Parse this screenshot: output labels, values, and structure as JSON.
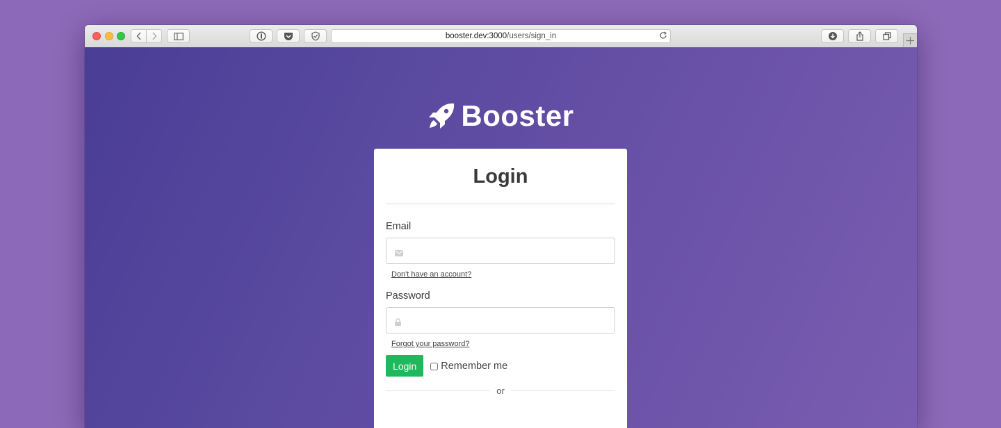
{
  "browser": {
    "url_host": "booster.dev:3000",
    "url_path": "/users/sign_in",
    "toolbar_icons": [
      "back-icon",
      "forward-icon",
      "sidebar-icon",
      "password-manager-icon",
      "pocket-icon",
      "shield-icon",
      "reload-icon",
      "download-icon",
      "share-icon",
      "tabs-icon",
      "new-tab-icon"
    ]
  },
  "brand": {
    "name": "Booster",
    "icon": "rocket-icon",
    "color": "#ffffff"
  },
  "login": {
    "title": "Login",
    "email_label": "Email",
    "email_value": "",
    "email_icon": "envelope-icon",
    "signup_link": "Don't have an account?",
    "password_label": "Password",
    "password_value": "",
    "password_icon": "lock-icon",
    "forgot_link": "Forgot your password?",
    "submit_label": "Login",
    "remember_label": "Remember me",
    "remember_checked": false,
    "separator": "or"
  },
  "colors": {
    "page_background": "#8c6ab9",
    "content_gradient_start": "#4a3d96",
    "content_gradient_end": "#7a5db0",
    "login_button": "#1fb85c"
  }
}
